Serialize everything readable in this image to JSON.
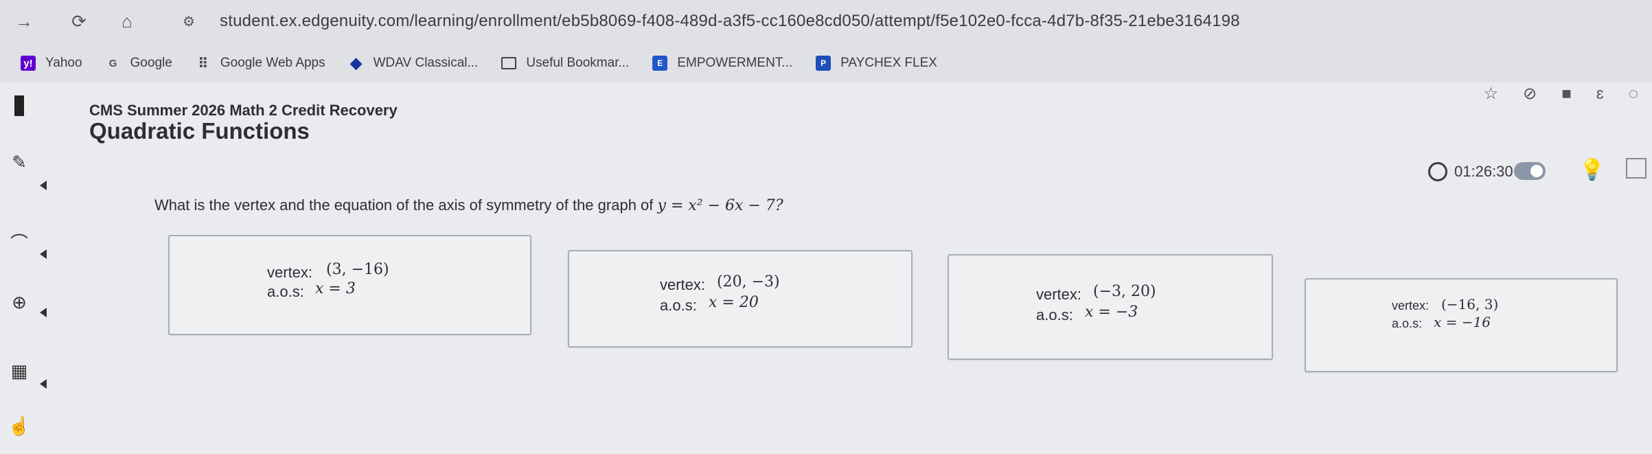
{
  "browser": {
    "url": "student.ex.edgenuity.com/learning/enrollment/eb5b8069-f408-489d-a3f5-cc160e8cd050/attempt/f5e102e0-fcca-4d7b-8f35-21ebe3164198",
    "bookmarks": [
      {
        "label": "Yahoo",
        "icon": "yahoo-icon"
      },
      {
        "label": "Google",
        "icon": "google-icon"
      },
      {
        "label": "Google Web Apps",
        "icon": "apps-grid-icon"
      },
      {
        "label": "WDAV Classical...",
        "icon": "diamond-icon"
      },
      {
        "label": "Useful Bookmar...",
        "icon": "folder-icon"
      },
      {
        "label": "EMPOWERMENT...",
        "icon": "empowerment-icon"
      },
      {
        "label": "PAYCHEX FLEX",
        "icon": "paychex-icon"
      }
    ]
  },
  "course": {
    "title": "CMS Summer 2026 Math 2 Credit Recovery",
    "unit": "Quadratic Functions"
  },
  "timer": {
    "value": "01:26:30"
  },
  "question": {
    "prefix": "What is the vertex and the equation of the axis of symmetry of the graph of",
    "equation": "y = x² − 6x − 7?"
  },
  "choices": [
    {
      "vertex_label": "vertex:",
      "vertex_value": "(3, −16)",
      "aos_label": "a.o.s:",
      "aos_value": "x = 3"
    },
    {
      "vertex_label": "vertex:",
      "vertex_value": "(20, −3)",
      "aos_label": "a.o.s:",
      "aos_value": "x = 20"
    },
    {
      "vertex_label": "vertex:",
      "vertex_value": "(−3, 20)",
      "aos_label": "a.o.s:",
      "aos_value": "x = −3"
    },
    {
      "vertex_label": "vertex:",
      "vertex_value": "(−16, 3)",
      "aos_label": "a.o.s:",
      "aos_value": "x = −16"
    }
  ]
}
